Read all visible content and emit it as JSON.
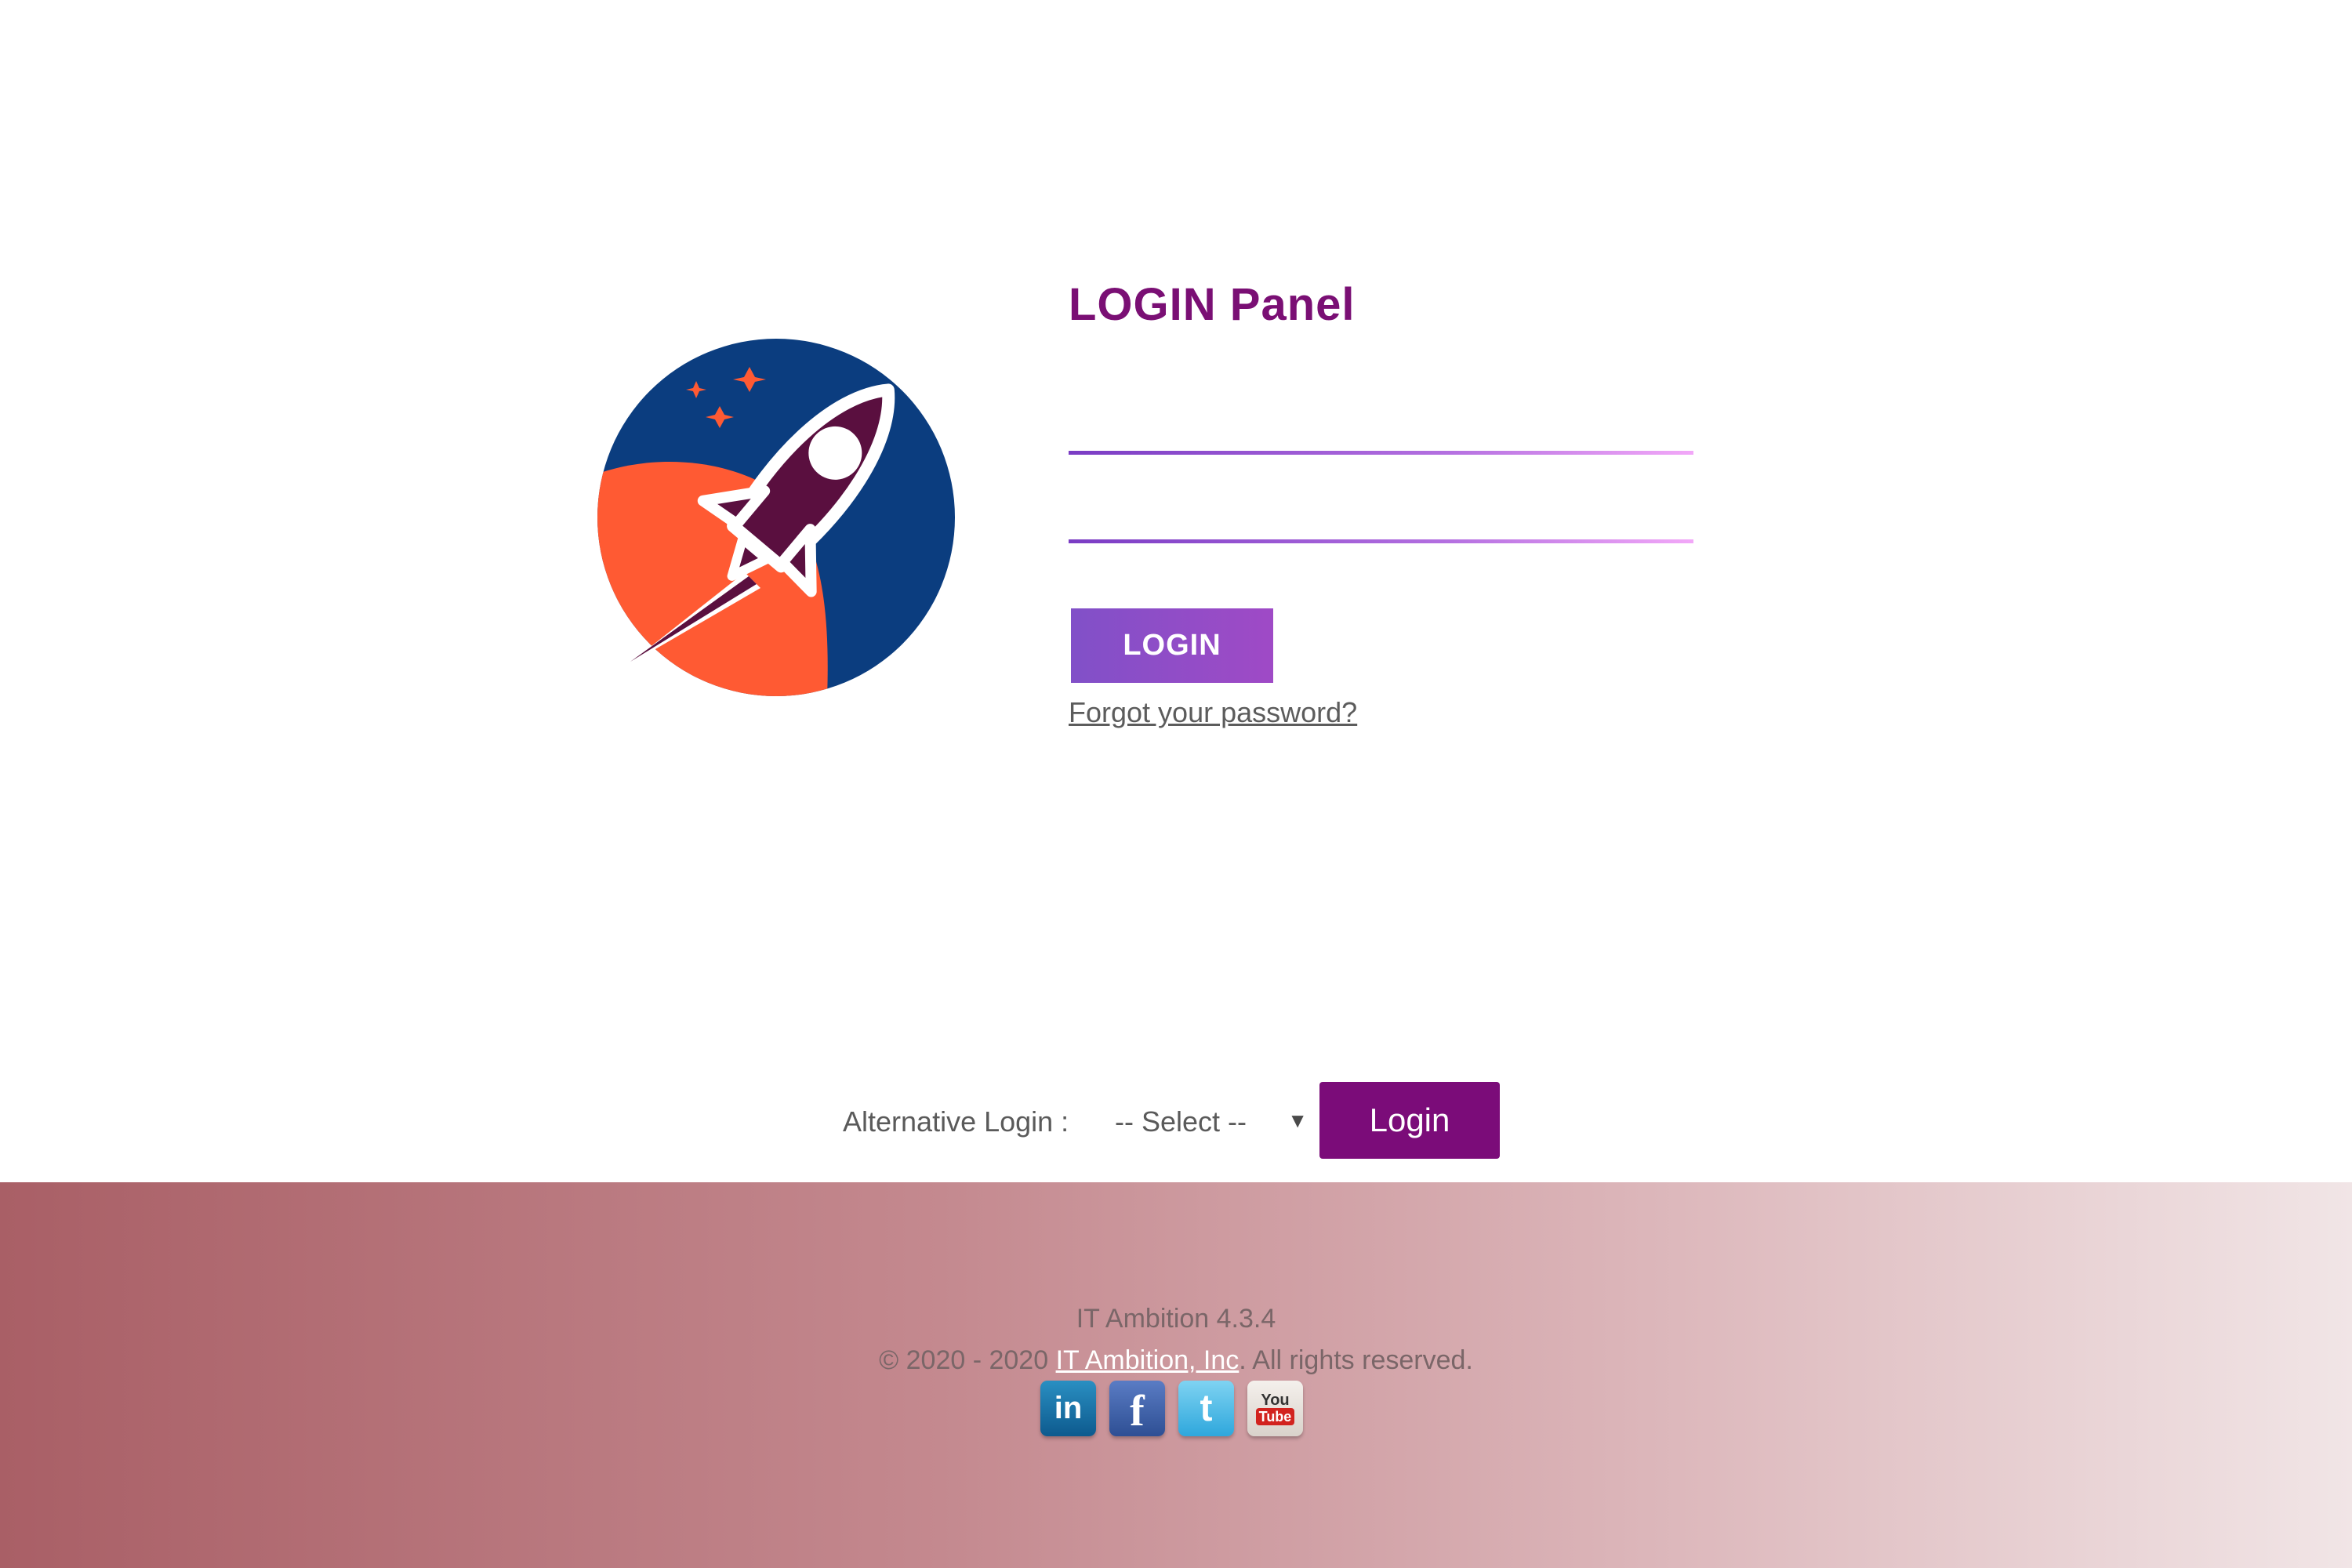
{
  "panel": {
    "title": "LOGIN Panel",
    "username_value": "",
    "password_value": "",
    "login_button": "LOGIN",
    "forgot_link": "Forgot your password?"
  },
  "alternative_login": {
    "label": "Alternative Login :",
    "selected": "-- Select --",
    "arrow": "▼",
    "button": "Login"
  },
  "footer": {
    "version": "IT Ambition 4.3.4",
    "copyright_prefix": "© 2020 - 2020 ",
    "company": "IT Ambition, Inc",
    "copyright_suffix": ". All rights reserved.",
    "social": [
      {
        "name": "linkedin",
        "icon": "linkedin-icon",
        "glyph": "in"
      },
      {
        "name": "facebook",
        "icon": "facebook-icon",
        "glyph": "f"
      },
      {
        "name": "twitter",
        "icon": "twitter-icon",
        "glyph": "t"
      },
      {
        "name": "youtube",
        "icon": "youtube-icon",
        "glyph_top": "You",
        "glyph_bottom": "Tube"
      }
    ]
  },
  "colors": {
    "brand_purple": "#7a0f74",
    "login_button": "#8150c8",
    "alt_login_button": "#7b0c79",
    "footer_start": "#a95f66",
    "footer_end": "#f1e5e6",
    "logo_navy": "#0b3d7f",
    "logo_orange": "#ff5a33",
    "logo_rocket": "#5a0f3f"
  }
}
